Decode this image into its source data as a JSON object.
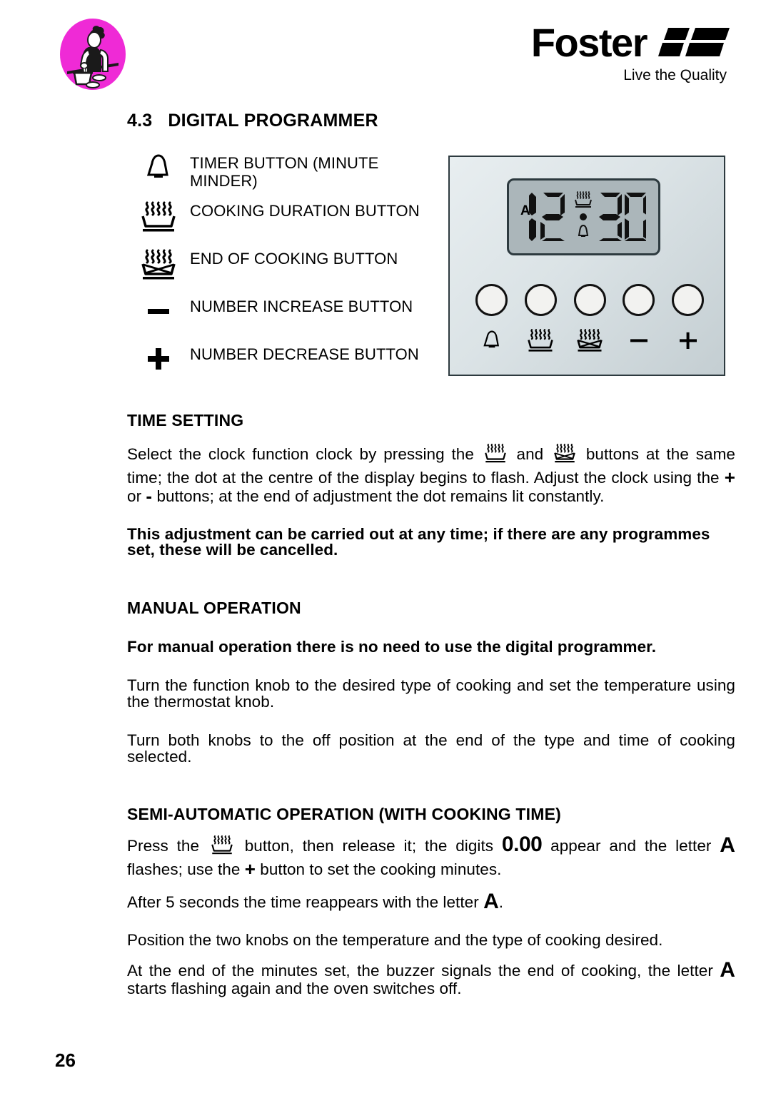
{
  "header": {
    "brand_name": "Foster",
    "tagline": "Live the Quality",
    "badge_icon": "chef-cooking-icon",
    "badge_color": "#ef2ad6"
  },
  "section": {
    "number": "4.3",
    "title": "DIGITAL PROGRAMMER"
  },
  "legend": {
    "items": [
      {
        "icon": "bell-icon",
        "label": "TIMER BUTTON (MINUTE MINDER)"
      },
      {
        "icon": "cooking-duration-icon",
        "label": "COOKING DURATION BUTTON"
      },
      {
        "icon": "end-of-cooking-icon",
        "label": "END OF COOKING BUTTON"
      },
      {
        "icon": "minus-icon",
        "label": "NUMBER INCREASE BUTTON"
      },
      {
        "icon": "plus-icon",
        "label": "NUMBER DECREASE BUTTON"
      }
    ]
  },
  "programmer": {
    "display": {
      "mode_letter": "A",
      "hours": "12",
      "minutes": "30",
      "separator": ":",
      "indicator_top": "cooking-duration-icon",
      "indicator_bottom": "bell-icon"
    },
    "buttons": [
      {
        "icon": "bell-icon",
        "name": "timer-button"
      },
      {
        "icon": "cooking-duration-icon",
        "name": "cooking-duration-button"
      },
      {
        "icon": "end-of-cooking-icon",
        "name": "end-of-cooking-button"
      },
      {
        "icon": "minus-icon",
        "name": "minus-button"
      },
      {
        "icon": "plus-icon",
        "name": "plus-button"
      }
    ]
  },
  "content": {
    "time_setting": {
      "title": "TIME SETTING",
      "para1_a": "Select the clock function clock by pressing the",
      "para1_b": "and",
      "para1_c": "buttons at the same time; the dot at the centre of the display begins to flash. Adjust the clock using the",
      "para1_d": "or",
      "para1_e": "buttons; at the end of adjustment the dot remains lit constantly.",
      "plus_symbol": "+",
      "minus_symbol": "-",
      "warning": "This adjustment can be carried out at any time; if there are any programmes set, these will be cancelled."
    },
    "manual_operation": {
      "title": "MANUAL OPERATION",
      "lead": "For manual operation there is no need to use the digital programmer.",
      "para1": "Turn the function knob to the desired type of cooking and set the temperature using the thermostat knob.",
      "para2": "Turn both knobs to the off position at the end of the type and time of cooking selected."
    },
    "semi_automatic": {
      "title": "SEMI-AUTOMATIC OPERATION (WITH COOKING TIME)",
      "para1_a": "Press the",
      "para1_b": "button, then release it; the digits",
      "digits": "0.00",
      "para1_c": "appear and the letter",
      "letter_a": "A",
      "para1_d": "flashes; use the",
      "plus_symbol": "+",
      "para1_e": "button to set the cooking minutes.",
      "para2_a": "After 5 seconds the time reappears with the letter",
      "para2_b": ".",
      "para3": "Position the two knobs on the temperature and the type of cooking desired.",
      "para4_a": "At the end of the minutes set, the buzzer signals the end of cooking, the letter",
      "para4_b": "starts flashing again and the oven switches off."
    }
  },
  "footer": {
    "page_number": "26"
  }
}
